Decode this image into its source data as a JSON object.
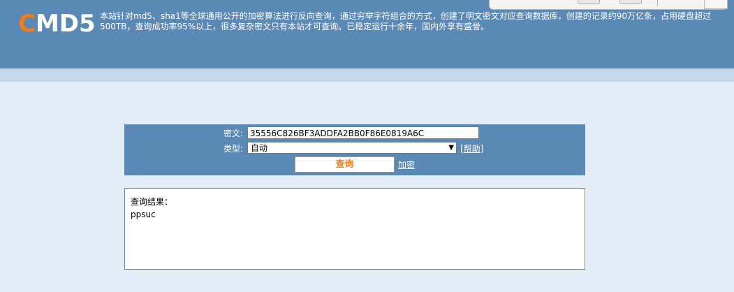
{
  "header": {
    "logo_first": "C",
    "logo_rest": "MD5",
    "intro": "本站针对md5、sha1等全球通用公开的加密算法进行反向查询，通过穷举字符组合的方式，创建了明文密文对应查询数据库，创建的记录约90万亿条，占用硬盘超过500TB，查询成功率95%以上，很多复杂密文只有本站才可查询。已稳定运行十余年，国内外享有盛誉。"
  },
  "form": {
    "cipher_label": "密文:",
    "cipher_value": "35556C826BF3ADDFA2BB0F86E0819A6C",
    "type_label": "类型:",
    "type_value": "自动",
    "help_link": "[帮助]",
    "query_button": "查询",
    "encrypt_link": "加密"
  },
  "result": {
    "label": "查询结果：",
    "value": "ppsuc"
  },
  "colors": {
    "header_bg": "#5b89b6",
    "page_bg": "#e3edf6",
    "accent": "#f07d1a"
  }
}
